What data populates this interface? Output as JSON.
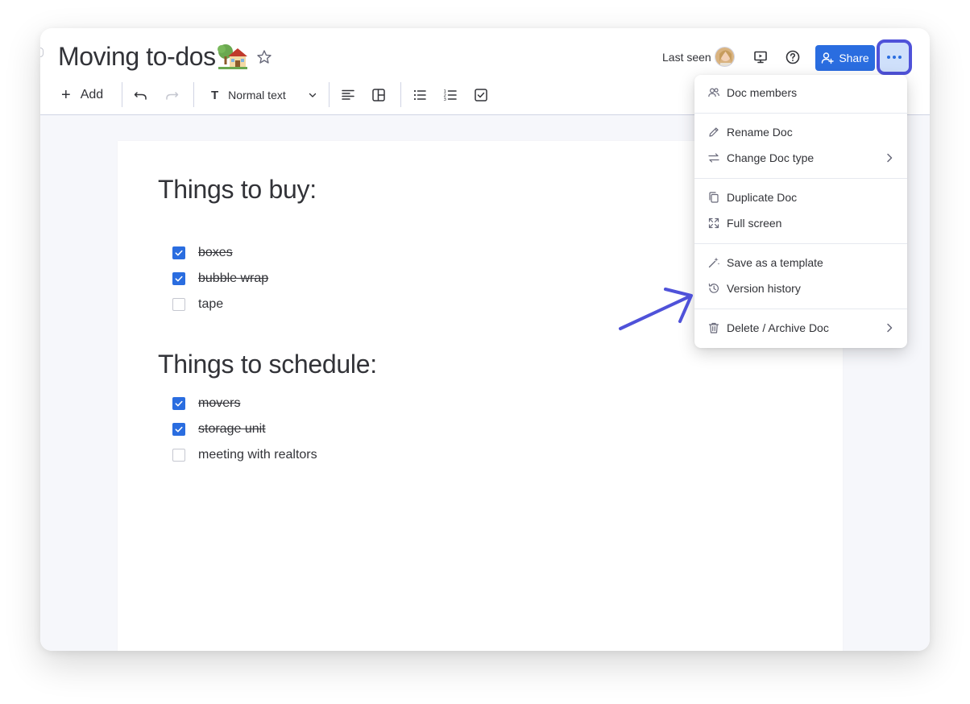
{
  "header": {
    "title": "Moving to-dos",
    "last_seen_label": "Last seen",
    "share_label": "Share"
  },
  "toolbar": {
    "add_label": "Add",
    "text_style_glyph": "T",
    "text_style_label": "Normal text"
  },
  "document": {
    "sections": [
      {
        "title": "Things to buy:",
        "items": [
          {
            "text": "boxes",
            "checked": true
          },
          {
            "text": "bubble wrap",
            "checked": true
          },
          {
            "text": "tape",
            "checked": false
          }
        ]
      },
      {
        "title": "Things to schedule:",
        "items": [
          {
            "text": "movers",
            "checked": true
          },
          {
            "text": "storage unit",
            "checked": true
          },
          {
            "text": "meeting with realtors",
            "checked": false
          }
        ]
      }
    ]
  },
  "menu": {
    "items": [
      {
        "label": "Doc members",
        "icon": "members-icon"
      },
      {
        "label": "Rename Doc",
        "icon": "pencil-icon"
      },
      {
        "label": "Change Doc type",
        "icon": "swap-icon",
        "has_submenu": true
      },
      {
        "label": "Duplicate Doc",
        "icon": "duplicate-icon"
      },
      {
        "label": "Full screen",
        "icon": "fullscreen-icon"
      },
      {
        "label": "Save as a template",
        "icon": "magic-wand-icon"
      },
      {
        "label": "Version history",
        "icon": "history-icon"
      },
      {
        "label": "Delete / Archive Doc",
        "icon": "trash-icon",
        "has_submenu": true
      }
    ]
  },
  "colors": {
    "accent": "#2a6de0",
    "highlight_border": "#4f52d9",
    "annotation_arrow": "#4f52d9",
    "text": "#323338"
  }
}
